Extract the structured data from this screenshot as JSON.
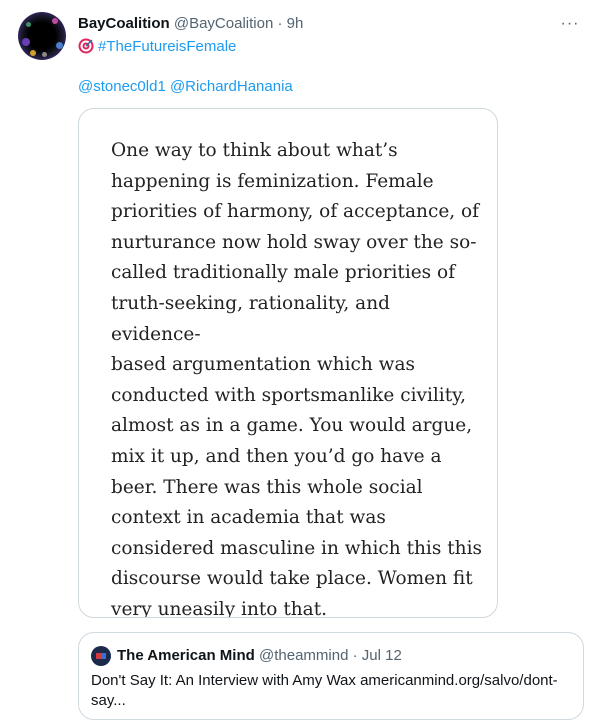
{
  "tweet": {
    "display_name": "BayCoalition",
    "handle": "@BayCoalition",
    "separator": "·",
    "time": "9h",
    "more_icon": "more-horizontal-icon",
    "more_glyph": "···",
    "bio_hashtag": "#TheFutureisFemale",
    "bio_icon": "target-icon",
    "mentions": [
      "@stonec0ld1",
      "@RichardHanania"
    ],
    "media_quote_text": "One way to think about what’s\nhappening is feminization. Female\npriorities of harmony, of acceptance, of\nnurturance now hold sway over the so-\ncalled traditionally male priorities of\ntruth-seeking, rationality, and evidence-\nbased argumentation which was\nconducted with sportsmanlike civility,\nalmost as in a game. You would argue,\nmix it up, and then you’d go have a\nbeer. There was this whole social\ncontext in academia that was\nconsidered masculine in which this this\ndiscourse would take place. Women fit\nvery uneasily into that."
  },
  "quoted_tweet": {
    "display_name": "The American Mind",
    "handle": "@theammind",
    "separator": "·",
    "time": "Jul 12",
    "body": "Don't Say It: An Interview with Amy Wax americanmind.org/salvo/dont-\nsay..."
  },
  "colors": {
    "link": "#1d9bf0",
    "secondary_text": "#536471",
    "border": "#cfd9de",
    "quote_avatar_bg": "#1b2a4a"
  }
}
